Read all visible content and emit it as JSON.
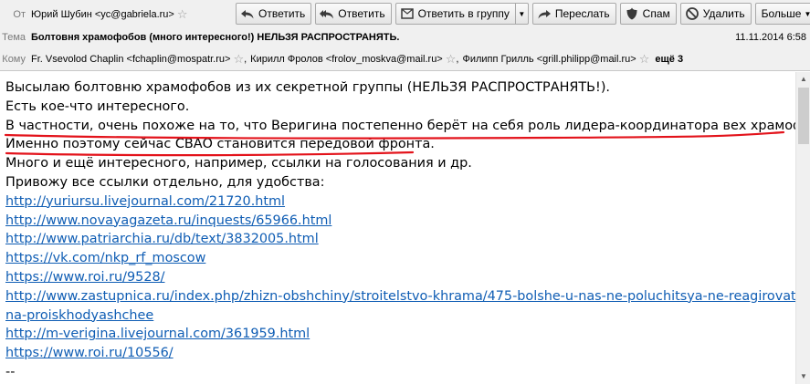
{
  "header": {
    "from": {
      "label": "От",
      "value": "Юрий Шубин <yc@gabriela.ru>"
    },
    "subject": {
      "label": "Тема",
      "value": "Болтовня храмофобов (много интересного!) НЕЛЬЗЯ РАСПРОСТРАНЯТЬ.",
      "date": "11.11.2014 6:58"
    },
    "to": {
      "label": "Кому",
      "recipients": [
        "Fr. Vsevolod Chaplin <fchaplin@mospatr.ru>",
        "Кирилл Фролов <frolov_moskva@mail.ru>",
        "Филипп Грилль <grill.philipp@mail.ru>"
      ],
      "more": "ещё 3"
    }
  },
  "toolbar": {
    "reply": "Ответить",
    "reply_all": "Ответить",
    "reply_group": "Ответить в группу",
    "forward": "Переслать",
    "spam": "Спам",
    "delete": "Удалить",
    "more": "Больше"
  },
  "body": {
    "lines": [
      "Высылаю болтовню храмофобов из их секретной группы (НЕЛЬЗЯ РАСПРОСТРАНЯТЬ!).",
      "Есть кое-что интересного.",
      "В частности, очень похоже на то, что Веригина постепенно берёт на себя роль лидера-координатора вех храмофобов.",
      "Именно поэтому сейчас СВАО становится передовой фронта.",
      "Много и ещё интересного, например, ссылки на голосования и др.",
      "Привожу все ссылки отдельно, для удобства:"
    ],
    "links": [
      "http://yuriursu.livejournal.com/21720.html",
      "http://www.novayagazeta.ru/inquests/65966.html",
      "http://www.patriarchia.ru/db/text/3832005.html",
      "https://vk.com/nkp_rf_moscow",
      "https://www.roi.ru/9528/",
      "http://www.zastupnica.ru/index.php/zhizn-obshchiny/stroitelstvo-khrama/475-bolshe-u-nas-ne-poluchitsya-ne-reagirovat-",
      "na-proiskhodyashchee",
      "http://m-verigina.livejournal.com/361959.html",
      "https://www.roi.ru/10556/"
    ],
    "signature": "--"
  },
  "icons": {
    "star": "star-icon",
    "reply": "reply-icon",
    "reply_all": "reply-all-icon",
    "reply_group": "reply-group-icon",
    "forward": "forward-icon",
    "spam": "spam-icon",
    "delete": "delete-icon"
  },
  "colors": {
    "link": "#0f5db4",
    "underline_mark": "#e3131b",
    "header_bg": "#f0f0f0"
  }
}
